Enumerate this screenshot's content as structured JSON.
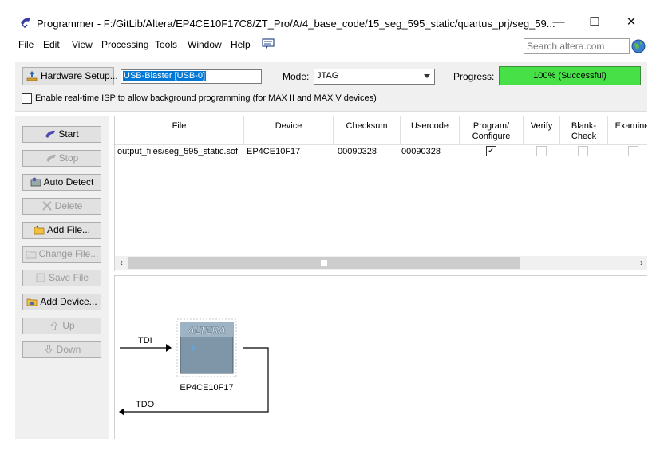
{
  "titlebar": {
    "title": "Programmer - F:/GitLib/Altera/EP4CE10F17C8/ZT_Pro/A/4_base_code/15_seg_595_static/quartus_prj/seg_59...",
    "icons": {
      "app": "programmer-icon",
      "minimize": "minimize-icon",
      "maximize": "maximize-icon",
      "close": "close-icon"
    },
    "minimize": "—",
    "maximize": "☐",
    "close": "✕"
  },
  "menubar": {
    "items": [
      "File",
      "Edit",
      "View",
      "Processing",
      "Tools",
      "Window",
      "Help"
    ],
    "search_placeholder": "Search altera.com",
    "icons": {
      "feedback": "feedback-icon",
      "globe": "globe-icon"
    }
  },
  "toolbar": {
    "hardware_setup_label": "Hardware Setup...",
    "hardware_value": "USB-Blaster [USB-0]",
    "mode_label": "Mode:",
    "mode_value": "JTAG",
    "progress_label": "Progress:",
    "progress_value": 1.0,
    "progress_text": "100% (Successful)",
    "isp_label": "Enable real-time ISP to allow background programming (for MAX II and MAX V devices)",
    "isp_checked": false,
    "colors": {
      "progress_fill": "#47e047"
    }
  },
  "side_buttons": [
    {
      "label": "Start",
      "icon": "start-icon",
      "enabled": true
    },
    {
      "label": "Stop",
      "icon": "stop-icon",
      "enabled": false
    },
    {
      "label": "Auto Detect",
      "icon": "auto-detect-icon",
      "enabled": true
    },
    {
      "label": "Delete",
      "icon": "delete-icon",
      "enabled": false
    },
    {
      "label": "Add File...",
      "icon": "add-file-icon",
      "enabled": true
    },
    {
      "label": "Change File...",
      "icon": "change-file-icon",
      "enabled": false
    },
    {
      "label": "Save File",
      "icon": "save-file-icon",
      "enabled": false
    },
    {
      "label": "Add Device...",
      "icon": "add-device-icon",
      "enabled": true
    },
    {
      "label": "Up",
      "icon": "up-icon",
      "enabled": false
    },
    {
      "label": "Down",
      "icon": "down-icon",
      "enabled": false
    }
  ],
  "table": {
    "columns": [
      "File",
      "Device",
      "Checksum",
      "Usercode",
      "Program/ Configure",
      "Verify",
      "Blank- Check",
      "Examine"
    ],
    "rows": [
      {
        "file": "output_files/seg_595_static.sof",
        "device": "EP4CE10F17",
        "checksum": "00090328",
        "usercode": "00090328",
        "program": true,
        "verify": false,
        "blank_check": false,
        "examine": false
      }
    ]
  },
  "chain": {
    "tdi": "TDI",
    "tdo": "TDO",
    "device_label": "EP4CE10F17",
    "logo_text": "ALTERA"
  }
}
